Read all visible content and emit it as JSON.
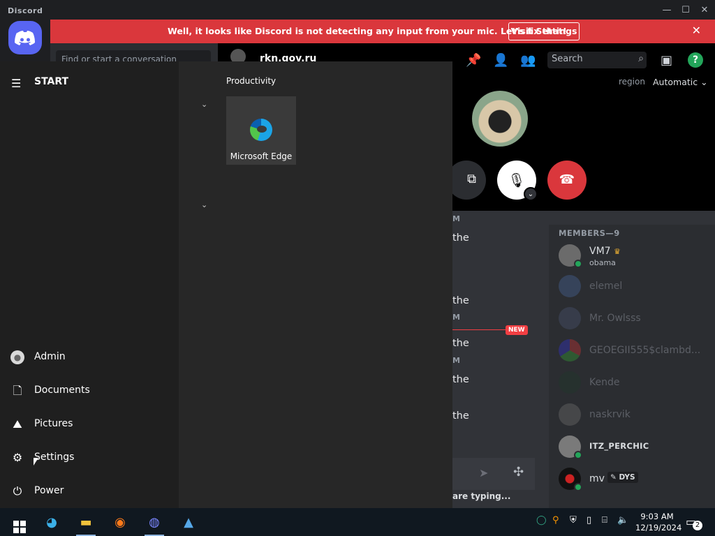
{
  "window": {
    "title": "Discord"
  },
  "notice": {
    "message": "Well, it looks like Discord is not detecting any input from your mic. Let's fix that!",
    "button": "Visit Settings"
  },
  "dm_search": {
    "placeholder": "Find or start a conversation"
  },
  "channel": {
    "name": "rkn.gov.ru"
  },
  "header": {
    "search_placeholder": "Search",
    "help": "?"
  },
  "call": {
    "region_label": "region",
    "region_value": "Automatic"
  },
  "chat": {
    "fragments": [
      "the",
      "the",
      "the",
      "the",
      "the"
    ],
    "timestamps": [
      "M",
      "M",
      "M"
    ],
    "new_badge": "NEW",
    "typing": "are typing..."
  },
  "members": {
    "heading": "MEMBERS—9",
    "list": [
      {
        "name": "VM7",
        "sub": "obama",
        "online": true,
        "crown": true
      },
      {
        "name": "elemel",
        "online": false
      },
      {
        "name": "Mr. Owlsss",
        "online": false
      },
      {
        "name": "GEOEGII555$clambd...",
        "online": false
      },
      {
        "name": "Kende",
        "online": false
      },
      {
        "name": "naskrvik",
        "online": false
      },
      {
        "name": "ITZ_PERCHIC",
        "online": true
      },
      {
        "name": "mv",
        "online": true,
        "tag": "DYS"
      }
    ]
  },
  "start_menu": {
    "title": "START",
    "group_label": "Productivity",
    "tiles": [
      {
        "label": "Microsoft Edge",
        "icon": "edge-icon"
      }
    ],
    "items": [
      {
        "label": "Admin",
        "icon": "user-icon"
      },
      {
        "label": "Documents",
        "icon": "document-icon"
      },
      {
        "label": "Pictures",
        "icon": "pictures-icon"
      },
      {
        "label": "Settings",
        "icon": "gear-icon"
      },
      {
        "label": "Power",
        "icon": "power-icon"
      }
    ]
  },
  "taskbar": {
    "apps": [
      "start",
      "edge-icon",
      "file-explorer-icon",
      "firefox-icon",
      "discord-icon",
      "photos-icon"
    ],
    "time": "9:03 AM",
    "date": "12/19/2024",
    "notification_count": "2"
  }
}
